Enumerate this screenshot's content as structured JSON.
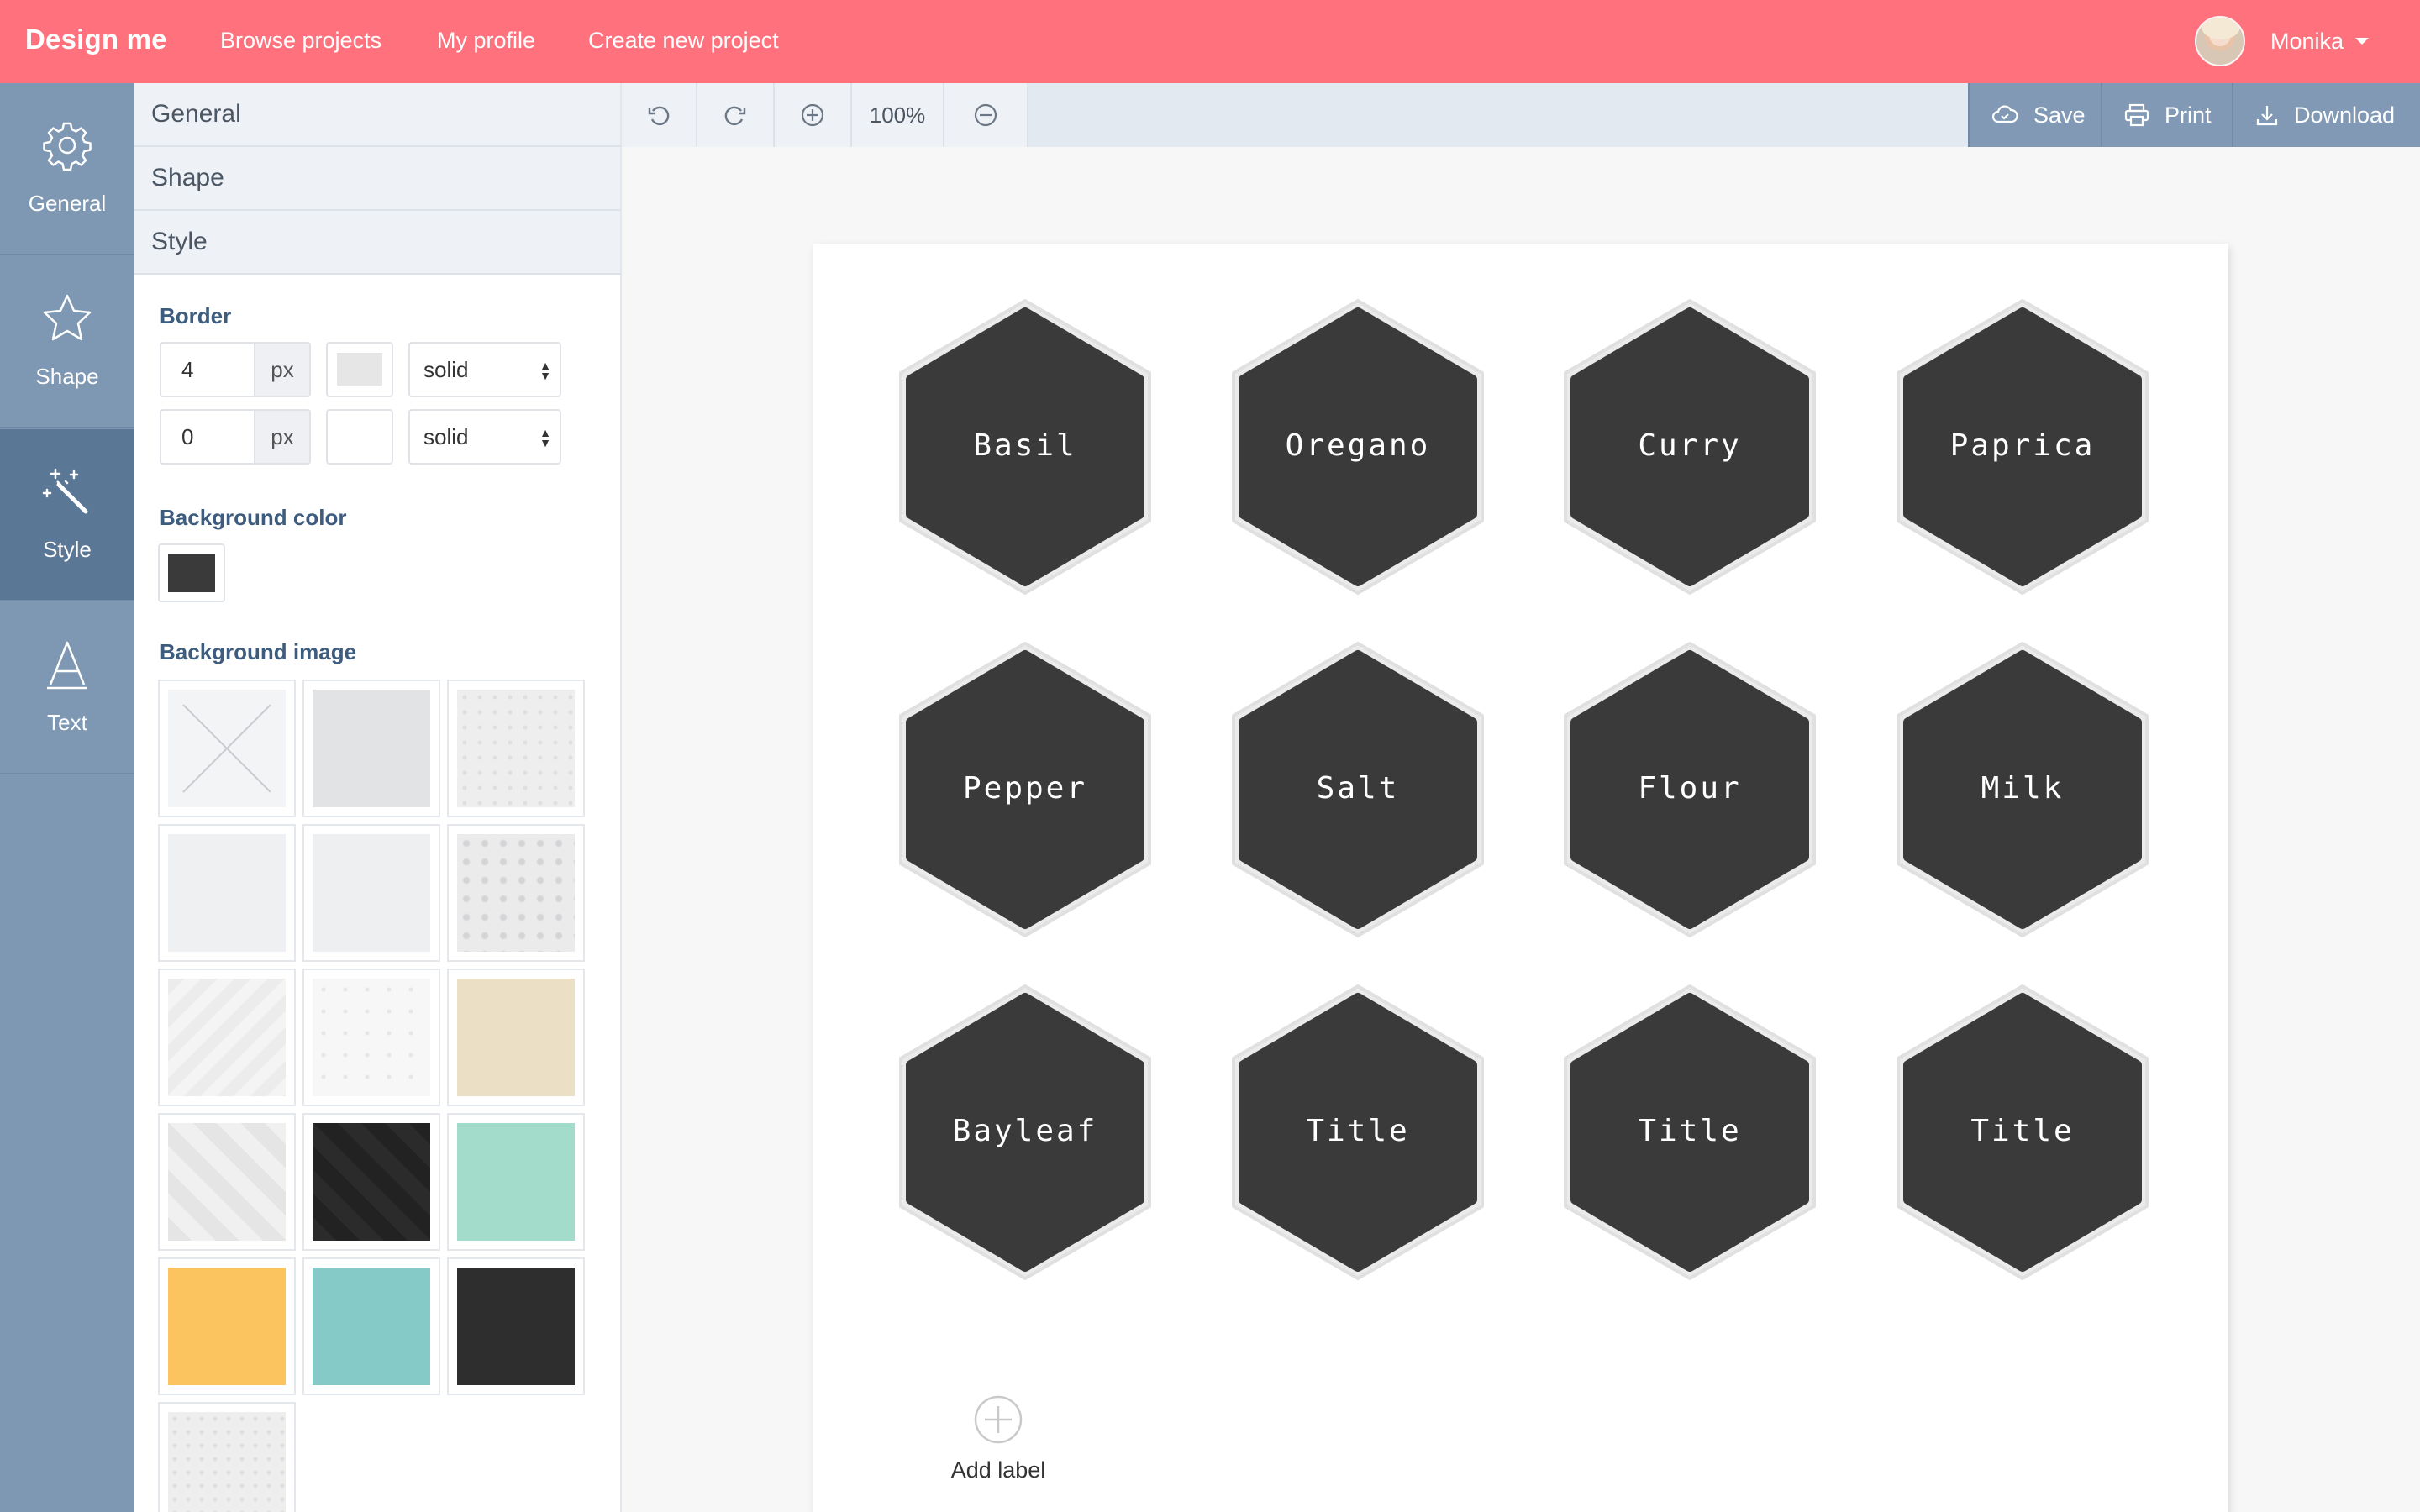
{
  "app": {
    "logo": "Design me",
    "nav": [
      "Browse projects",
      "My profile",
      "Create new project"
    ],
    "user": "Monika"
  },
  "rail": [
    {
      "label": "General",
      "icon": "gear-icon"
    },
    {
      "label": "Shape",
      "icon": "star-icon"
    },
    {
      "label": "Style",
      "icon": "magic-wand-icon"
    },
    {
      "label": "Text",
      "icon": "text-a-icon"
    }
  ],
  "panel": {
    "tabs": [
      "General",
      "Shape",
      "Style"
    ],
    "border_title": "Border",
    "border_rows": [
      {
        "width": "4",
        "unit": "px",
        "color": "#e6e6e6",
        "style": "solid"
      },
      {
        "width": "0",
        "unit": "px",
        "color": "#ffffff",
        "style": "solid"
      }
    ],
    "bg_color_title": "Background color",
    "bg_color": "#3a3a3a",
    "bg_image_title": "Background image"
  },
  "toolbar": {
    "zoom": "100%",
    "save": "Save",
    "print": "Print",
    "download": "Download"
  },
  "labels": [
    "Basil",
    "Oregano",
    "Curry",
    "Paprica",
    "Pepper",
    "Salt",
    "Flour",
    "Milk",
    "Bayleaf",
    "Title",
    "Title",
    "Title"
  ],
  "label_fill": "#3a3a3a",
  "label_border": "#e6e6e6",
  "add_label": "Add label",
  "colors": {
    "brand": "#ff727d",
    "rail": "#7e97b2",
    "rail_active": "#5b7796",
    "action": "#8199b4"
  }
}
